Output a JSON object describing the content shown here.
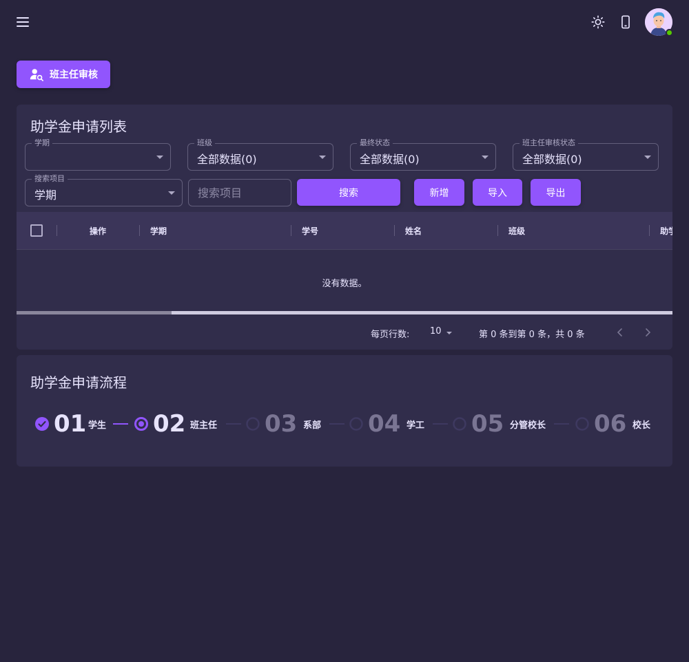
{
  "header": {
    "menu_icon": "hamburger-menu-icon",
    "theme_icon": "sun-brightness-icon",
    "device_icon": "mobile-device-icon",
    "avatar_status": "online"
  },
  "toolbar": {
    "review_button_label": "班主任审核",
    "review_icon": "user-search-icon"
  },
  "list_card": {
    "title": "助学金申请列表",
    "filters": [
      {
        "label": "学期",
        "value": ""
      },
      {
        "label": "班级",
        "value": "全部数据(0)"
      },
      {
        "label": "最终状态",
        "value": "全部数据(0)"
      },
      {
        "label": "班主任审核状态",
        "value": "全部数据(0)"
      }
    ],
    "search_field": {
      "label": "搜索项目",
      "value": "学期"
    },
    "search_input": {
      "placeholder": "搜索项目",
      "value": ""
    },
    "buttons": {
      "search": "搜索",
      "add": "新增",
      "import": "导入",
      "export": "导出"
    },
    "table": {
      "columns": [
        "操作",
        "学期",
        "学号",
        "姓名",
        "班级",
        "助学"
      ],
      "empty_text": "没有数据。"
    },
    "pagination": {
      "rows_per_page_label": "每页行数:",
      "rows_per_page": "10",
      "range_text": "第 0 条到第 0 条，共 0 条"
    }
  },
  "flow_card": {
    "title": "助学金申请流程",
    "steps": [
      {
        "num": "01",
        "label": "学生",
        "state": "done"
      },
      {
        "num": "02",
        "label": "班主任",
        "state": "active"
      },
      {
        "num": "03",
        "label": "系部",
        "state": "pending"
      },
      {
        "num": "04",
        "label": "学工",
        "state": "pending"
      },
      {
        "num": "05",
        "label": "分管校长",
        "state": "pending"
      },
      {
        "num": "06",
        "label": "校长",
        "state": "pending"
      }
    ]
  },
  "colors": {
    "background": "#28243d",
    "card": "#312d4b",
    "table_header": "#3b3559",
    "primary": "#9155fd",
    "text": "#e7e3fc",
    "muted_step": "#7a7593",
    "online_dot": "#56ca00"
  }
}
